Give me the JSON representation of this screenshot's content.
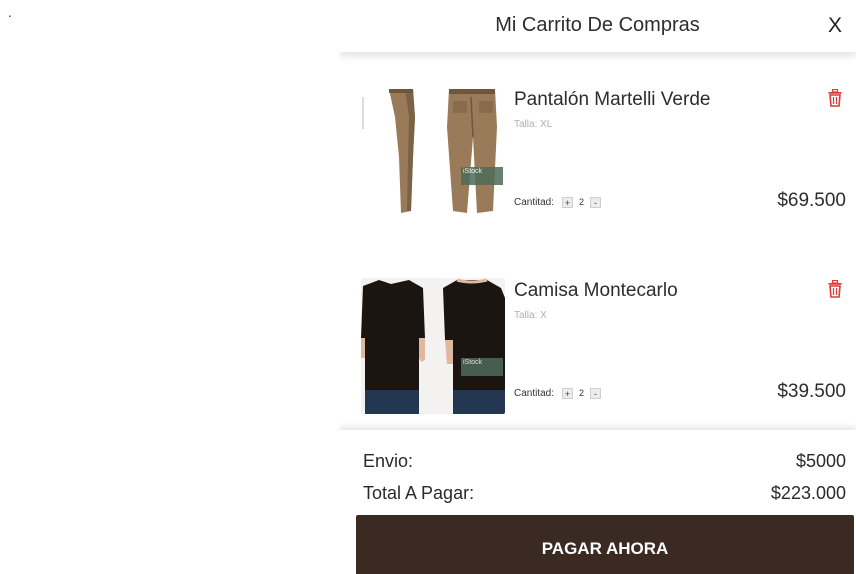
{
  "stray_mark": ".",
  "cart": {
    "title": "Mi Carrito De Compras",
    "close_label": "X",
    "items": [
      {
        "name": "Pantalón  Martelli Verde",
        "size": "Talla: XL",
        "qty_label": "Cantitad:",
        "qty_plus": "+",
        "qty_value": "2",
        "qty_minus": "-",
        "price": "$69.500",
        "stock_tag": "iStock",
        "image": "pants-photo",
        "delete_icon": "trash-icon",
        "colors": {
          "garment": "#9a7b59",
          "shadow": "#6f563c"
        }
      },
      {
        "name": "Camisa  Montecarlo",
        "size": "Talla: X",
        "qty_label": "Cantitad:",
        "qty_plus": "+",
        "qty_value": "2",
        "qty_minus": "-",
        "price": "$39.500",
        "stock_tag": "iStock",
        "image": "shirt-photo",
        "delete_icon": "trash-icon",
        "colors": {
          "garment": "#1b1512",
          "skin": "#e0b8a0",
          "jeans": "#233752"
        }
      }
    ],
    "summary": {
      "shipping_label": "Envio:",
      "shipping_value": "$5000",
      "total_label": "Total  A Pagar:",
      "total_value": "$223.000"
    },
    "pay_button": "PAGAR AHORA"
  },
  "colors": {
    "accent_delete": "#e03a3a",
    "pay_button_bg": "#3a2a22",
    "muted_text": "#b0b0b0"
  }
}
